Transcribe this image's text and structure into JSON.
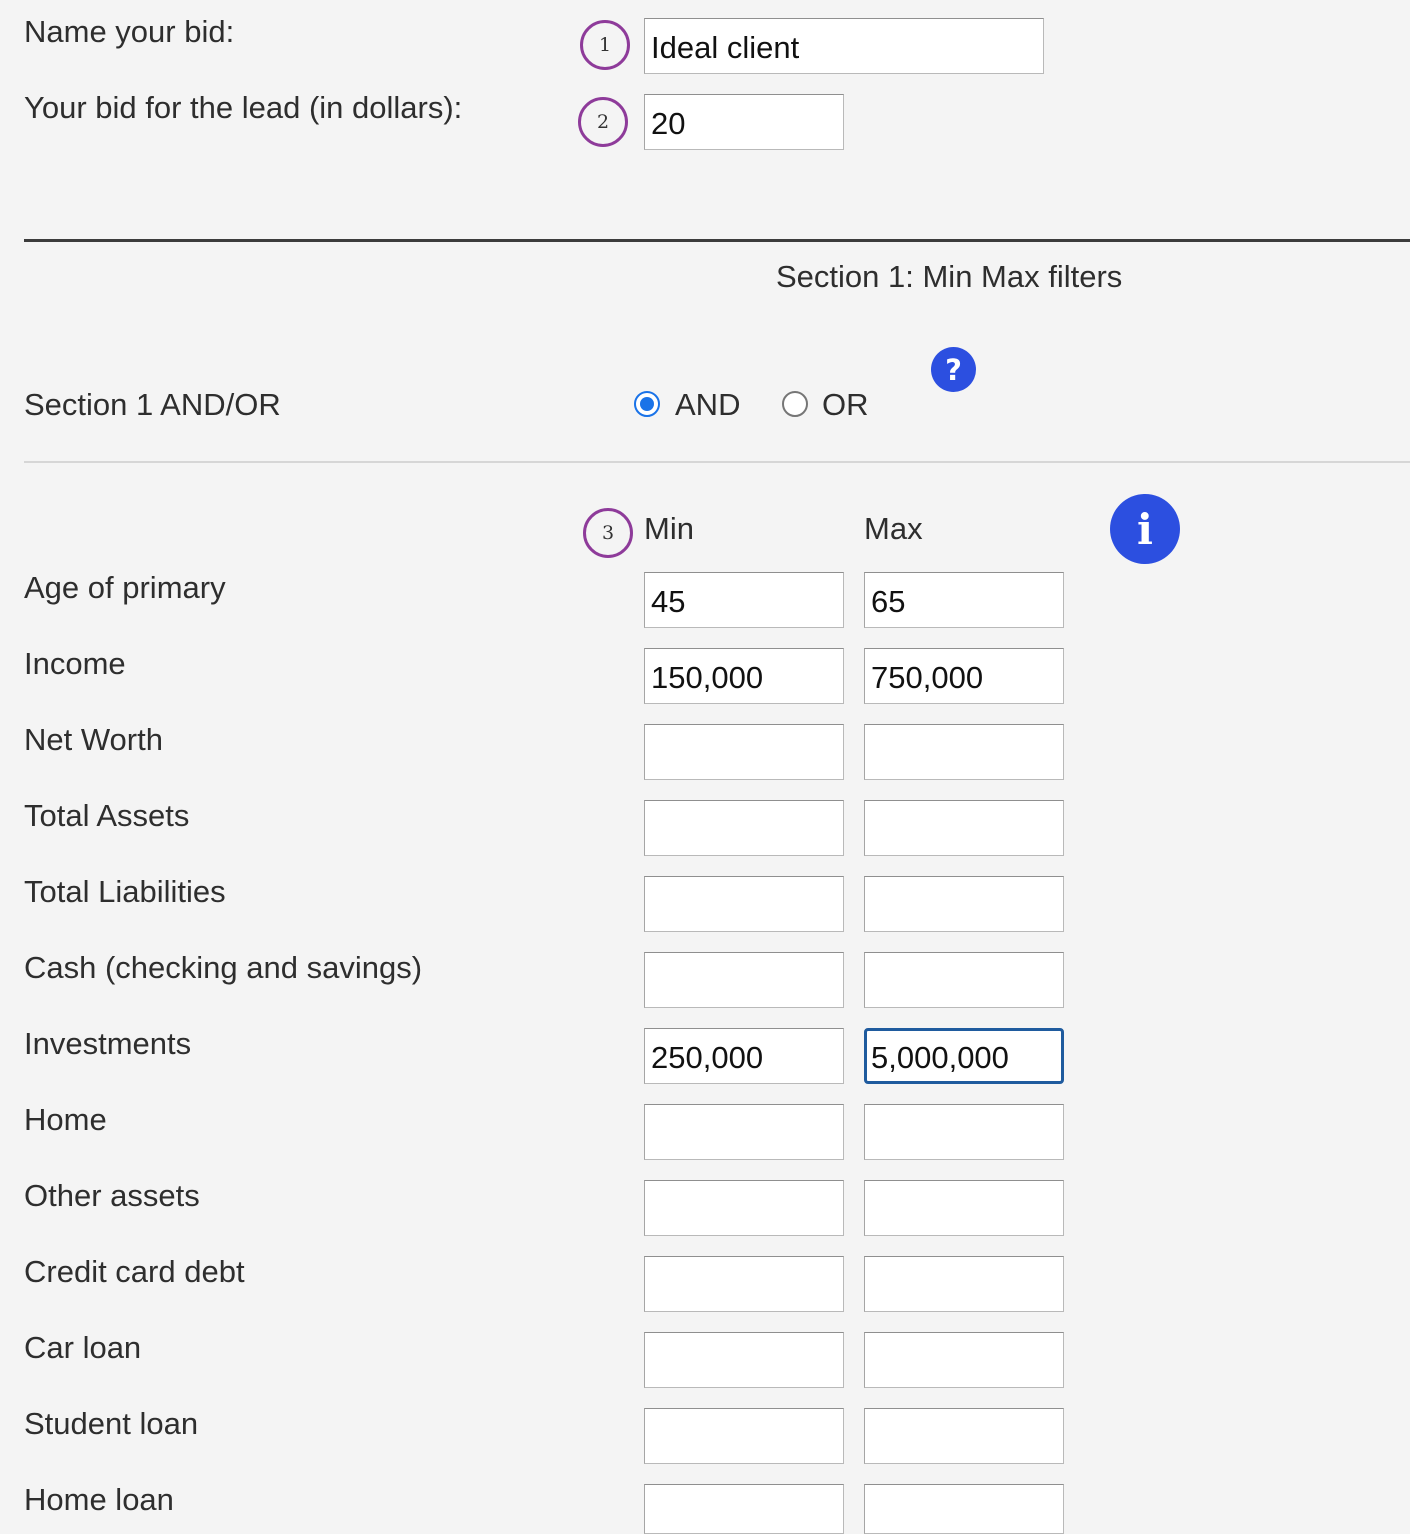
{
  "bid": {
    "name_label": "Name your bid:",
    "name_value": "Ideal client",
    "name_marker": "1",
    "amount_label": "Your bid for the lead (in dollars):",
    "amount_value": "20",
    "amount_marker": "2"
  },
  "section1": {
    "title": "Section 1: Min Max filters",
    "andor_label": "Section 1 AND/OR",
    "and_label": "AND",
    "or_label": "OR",
    "selected": "AND",
    "help_icon": "question-icon",
    "info_icon": "info-icon",
    "minmax_marker": "3",
    "min_header": "Min",
    "max_header": "Max",
    "rows": [
      {
        "label": "Age of primary",
        "min": "45",
        "max": "65"
      },
      {
        "label": "Income",
        "min": "150,000",
        "max": "750,000"
      },
      {
        "label": "Net Worth",
        "min": "",
        "max": ""
      },
      {
        "label": "Total Assets",
        "min": "",
        "max": ""
      },
      {
        "label": "Total Liabilities",
        "min": "",
        "max": ""
      },
      {
        "label": "Cash (checking and savings)",
        "min": "",
        "max": ""
      },
      {
        "label": "Investments",
        "min": "250,000",
        "max": "5,000,000"
      },
      {
        "label": "Home",
        "min": "",
        "max": ""
      },
      {
        "label": "Other assets",
        "min": "",
        "max": ""
      },
      {
        "label": "Credit card debt",
        "min": "",
        "max": ""
      },
      {
        "label": "Car loan",
        "min": "",
        "max": ""
      },
      {
        "label": "Student loan",
        "min": "",
        "max": ""
      },
      {
        "label": "Home loan",
        "min": "",
        "max": ""
      }
    ]
  },
  "colors": {
    "background": "#f4f4f4",
    "marker_ring": "#8e3b9a",
    "icon_blue": "#2c4fe0",
    "radio_blue": "#1a73e8",
    "focus_border": "#1f5b9e"
  }
}
